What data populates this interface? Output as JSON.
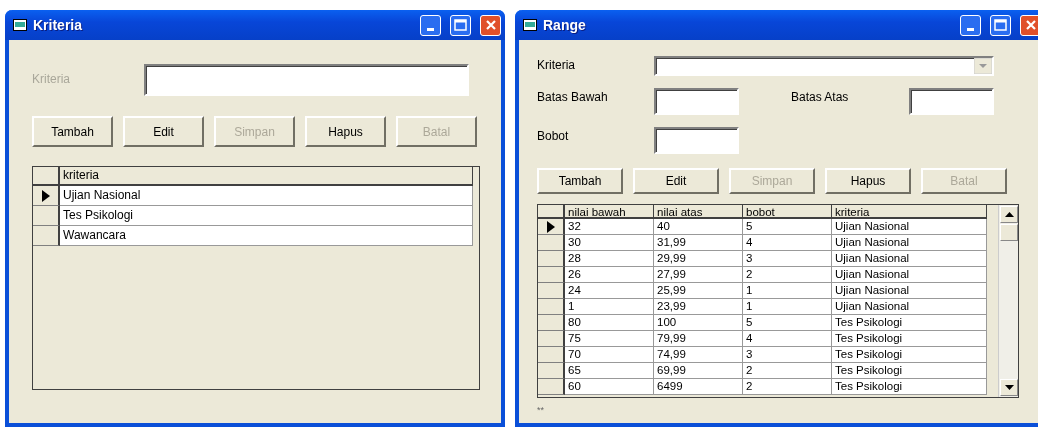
{
  "windows": [
    {
      "title": "Kriteria",
      "form": [
        {
          "kind": "text",
          "label": "Kriteria",
          "label_disabled": true
        }
      ],
      "buttons": [
        {
          "label": "Tambah",
          "disabled": false
        },
        {
          "label": "Edit",
          "disabled": false
        },
        {
          "label": "Simpan",
          "disabled": true
        },
        {
          "label": "Hapus",
          "disabled": false
        },
        {
          "label": "Batal",
          "disabled": true
        }
      ],
      "grid": {
        "columns": [
          "kriteria"
        ],
        "rows": [
          {
            "selected": true,
            "cells": [
              "Ujian Nasional"
            ]
          },
          {
            "selected": false,
            "cells": [
              "Tes Psikologi"
            ]
          },
          {
            "selected": false,
            "cells": [
              "Wawancara"
            ]
          }
        ]
      }
    },
    {
      "title": "Range",
      "form": [
        {
          "kind": "combo",
          "label": "Kriteria",
          "label_disabled": false
        },
        {
          "kind": "pair",
          "label": "Batas Bawah",
          "label_disabled": false,
          "label_2": "Batas Atas"
        },
        {
          "kind": "text",
          "label": "Bobot",
          "label_disabled": false
        }
      ],
      "buttons": [
        {
          "label": "Tambah",
          "disabled": false
        },
        {
          "label": "Edit",
          "disabled": false
        },
        {
          "label": "Simpan",
          "disabled": true
        },
        {
          "label": "Hapus",
          "disabled": false
        },
        {
          "label": "Batal",
          "disabled": true
        }
      ],
      "grid": {
        "columns": [
          "nilai bawah",
          "nilai atas",
          "bobot",
          "kriteria"
        ],
        "scrollbar": true,
        "rows": [
          {
            "selected": true,
            "cells": [
              "32",
              "40",
              "5",
              "Ujian Nasional"
            ]
          },
          {
            "selected": false,
            "cells": [
              "30",
              "31,99",
              "4",
              "Ujian Nasional"
            ]
          },
          {
            "selected": false,
            "cells": [
              "28",
              "29,99",
              "3",
              "Ujian Nasional"
            ]
          },
          {
            "selected": false,
            "cells": [
              "26",
              "27,99",
              "2",
              "Ujian Nasional"
            ]
          },
          {
            "selected": false,
            "cells": [
              "24",
              "25,99",
              "1",
              "Ujian Nasional"
            ]
          },
          {
            "selected": false,
            "cells": [
              "1",
              "23,99",
              "1",
              "Ujian Nasional"
            ]
          },
          {
            "selected": false,
            "cells": [
              "80",
              "100",
              "5",
              "Tes Psikologi"
            ]
          },
          {
            "selected": false,
            "cells": [
              "75",
              "79,99",
              "4",
              "Tes Psikologi"
            ]
          },
          {
            "selected": false,
            "cells": [
              "70",
              "74,99",
              "3",
              "Tes Psikologi"
            ]
          },
          {
            "selected": false,
            "cells": [
              "65",
              "69,99",
              "2",
              "Tes Psikologi"
            ]
          },
          {
            "selected": false,
            "cells": [
              "60",
              "6499",
              "2",
              "Tes Psikologi"
            ]
          }
        ]
      },
      "footer": "**"
    }
  ]
}
